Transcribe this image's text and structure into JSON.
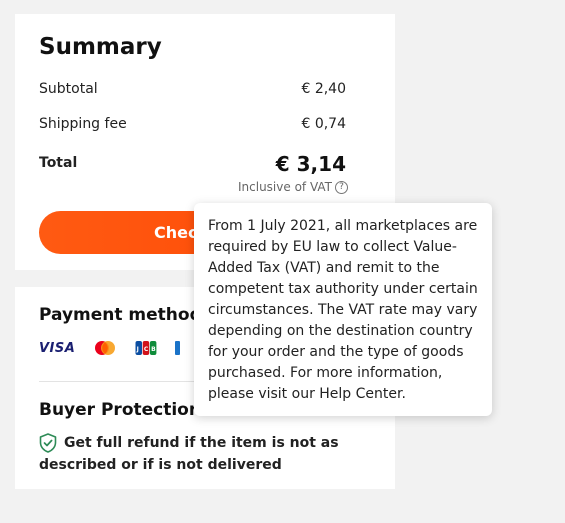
{
  "summary": {
    "title": "Summary",
    "subtotal_label": "Subtotal",
    "subtotal_value": "€ 2,40",
    "shipping_label": "Shipping fee",
    "shipping_value": "€ 0,74",
    "total_label": "Total",
    "total_value": "€ 3,14",
    "vat_note": "Inclusive of VAT",
    "checkout_label": "Chec"
  },
  "payment": {
    "title": "Payment method",
    "methods": [
      "VISA",
      "mastercard-icon",
      "jcb-icon",
      "card-icon"
    ]
  },
  "protection": {
    "title": "Buyer Protection",
    "text": "Get full refund if the item is not as described or if is not delivered"
  },
  "tooltip": {
    "text": "From 1 July 2021, all marketplaces are required by EU law to collect Value-Added Tax (VAT) and remit to the competent tax authority under certain circumstances. The VAT rate may vary depending on the destination country for your order and the type of goods purchased. For more information, please visit our Help Center."
  },
  "colors": {
    "accent": "#ff5a12",
    "visa": "#1a1f71",
    "shield": "#2e8b57"
  }
}
